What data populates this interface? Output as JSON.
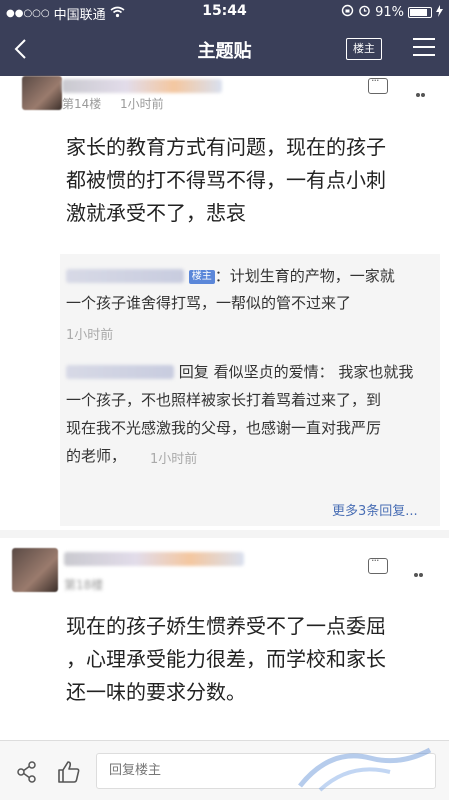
{
  "status_bar": {
    "signal": "●●○○○",
    "carrier": "中国联通",
    "time": "15:44",
    "battery": "91%",
    "battery_level": 0.91
  },
  "nav": {
    "title": "主题贴",
    "owner_button": "楼主"
  },
  "posts": [
    {
      "floor": "第14楼",
      "time": "1小时前",
      "lines": [
        "家长的教育方式有问题，现在的孩子",
        "都被惯的打不得骂不得，一有点小刺",
        "激就承受不了，悲哀"
      ],
      "replies": [
        {
          "owner_tag": "楼主",
          "lines": [
            "：计划生育的产物，一家就",
            "一个孩子谁舍得打骂，一帮似的管不过来了"
          ],
          "time": "1小时前"
        },
        {
          "reply_word": "回复",
          "target": "看似坚贞的爱情：",
          "lines": [
            "我家也就我",
            "一个孩子，不也照样被家长打着骂着过来了，到",
            "现在我不光感激我的父母，也感谢一直对我严厉",
            "的老师，"
          ],
          "time": "1小时前"
        }
      ],
      "more_replies": "更多3条回复..."
    },
    {
      "floor": "第18楼",
      "lines": [
        "现在的孩子娇生惯养受不了一点委屈",
        "，心理承受能力很差，而学校和家长",
        "还一味的要求分数。"
      ]
    }
  ],
  "bottom_bar": {
    "reply_placeholder": "回复楼主"
  }
}
